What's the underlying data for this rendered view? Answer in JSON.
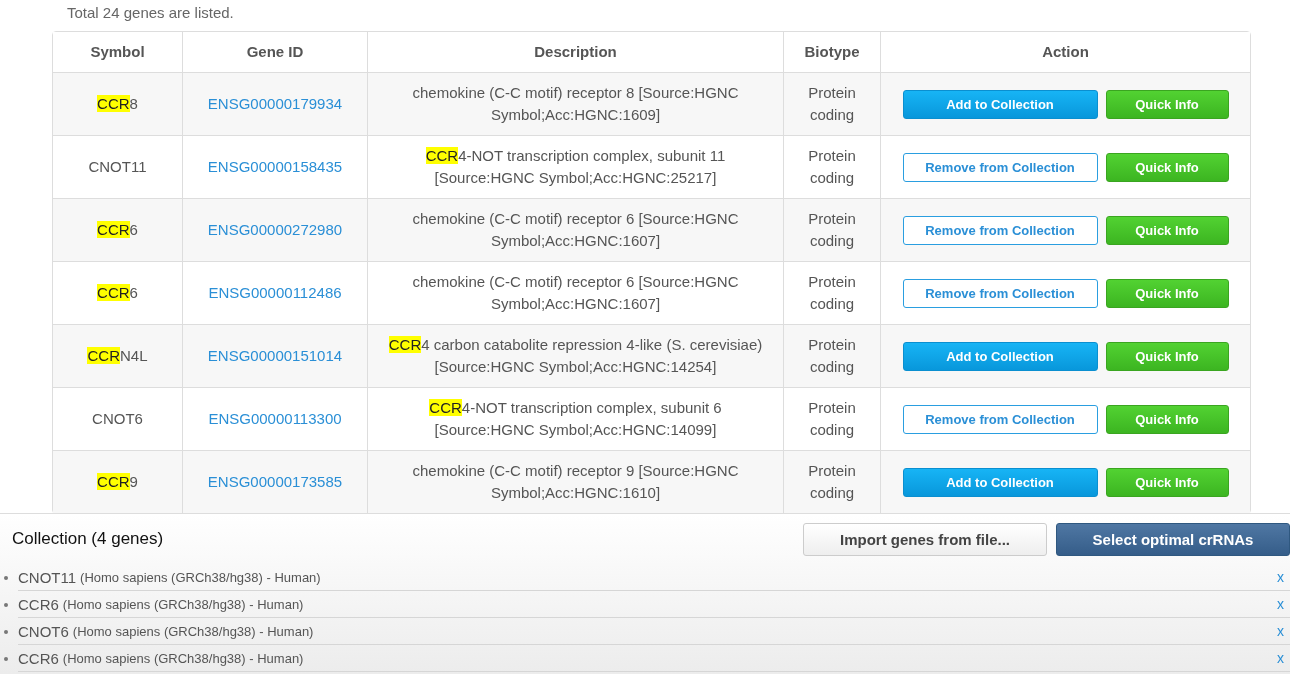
{
  "summary": "Total 24 genes are listed.",
  "table": {
    "columns": [
      "Symbol",
      "Gene ID",
      "Description",
      "Biotype",
      "Action"
    ],
    "rows": [
      {
        "symbol": {
          "match": "CCR",
          "rest": "8"
        },
        "gene_id": "ENSG00000179934",
        "description": {
          "rest": "chemokine (C-C motif) receptor 8 [Source:HGNC Symbol;Acc:HGNC:1609]"
        },
        "biotype": "Protein coding",
        "in_collection": false,
        "collection_button": "Add to Collection",
        "info_button": "Quick Info"
      },
      {
        "symbol": {
          "rest": "CNOT11"
        },
        "gene_id": "ENSG00000158435",
        "description": {
          "match": "CCR",
          "rest": "4-NOT transcription complex, subunit 11 [Source:HGNC Symbol;Acc:HGNC:25217]"
        },
        "biotype": "Protein coding",
        "in_collection": true,
        "collection_button": "Remove from Collection",
        "info_button": "Quick Info"
      },
      {
        "symbol": {
          "match": "CCR",
          "rest": "6"
        },
        "gene_id": "ENSG00000272980",
        "description": {
          "rest": "chemokine (C-C motif) receptor 6 [Source:HGNC Symbol;Acc:HGNC:1607]"
        },
        "biotype": "Protein coding",
        "in_collection": true,
        "collection_button": "Remove from Collection",
        "info_button": "Quick Info"
      },
      {
        "symbol": {
          "match": "CCR",
          "rest": "6"
        },
        "gene_id": "ENSG00000112486",
        "description": {
          "rest": "chemokine (C-C motif) receptor 6 [Source:HGNC Symbol;Acc:HGNC:1607]"
        },
        "biotype": "Protein coding",
        "in_collection": true,
        "collection_button": "Remove from Collection",
        "info_button": "Quick Info"
      },
      {
        "symbol": {
          "match": "CCR",
          "rest": "N4L"
        },
        "gene_id": "ENSG00000151014",
        "description": {
          "match": "CCR",
          "rest": "4 carbon catabolite repression 4-like (S. cerevisiae) [Source:HGNC Symbol;Acc:HGNC:14254]"
        },
        "biotype": "Protein coding",
        "in_collection": false,
        "collection_button": "Add to Collection",
        "info_button": "Quick Info"
      },
      {
        "symbol": {
          "rest": "CNOT6"
        },
        "gene_id": "ENSG00000113300",
        "description": {
          "match": "CCR",
          "rest": "4-NOT transcription complex, subunit 6 [Source:HGNC Symbol;Acc:HGNC:14099]"
        },
        "biotype": "Protein coding",
        "in_collection": true,
        "collection_button": "Remove from Collection",
        "info_button": "Quick Info"
      },
      {
        "symbol": {
          "match": "CCR",
          "rest": "9"
        },
        "gene_id": "ENSG00000173585",
        "description": {
          "rest": "chemokine (C-C motif) receptor 9 [Source:HGNC Symbol;Acc:HGNC:1610]"
        },
        "biotype": "Protein coding",
        "in_collection": false,
        "collection_button": "Add to Collection",
        "info_button": "Quick Info"
      }
    ]
  },
  "collection": {
    "title": "Collection (4 genes)",
    "import_button": "Import genes from file...",
    "select_button": "Select optimal crRNAs",
    "items": [
      {
        "symbol": "CNOT11",
        "organism": "(Homo sapiens (GRCh38/hg38) - Human)",
        "remove": "x"
      },
      {
        "symbol": "CCR6",
        "organism": "(Homo sapiens (GRCh38/hg38) - Human)",
        "remove": "x"
      },
      {
        "symbol": "CNOT6",
        "organism": "(Homo sapiens (GRCh38/hg38) - Human)",
        "remove": "x"
      },
      {
        "symbol": "CCR6",
        "organism": "(Homo sapiens (GRCh38/hg38) - Human)",
        "remove": "x"
      }
    ]
  }
}
